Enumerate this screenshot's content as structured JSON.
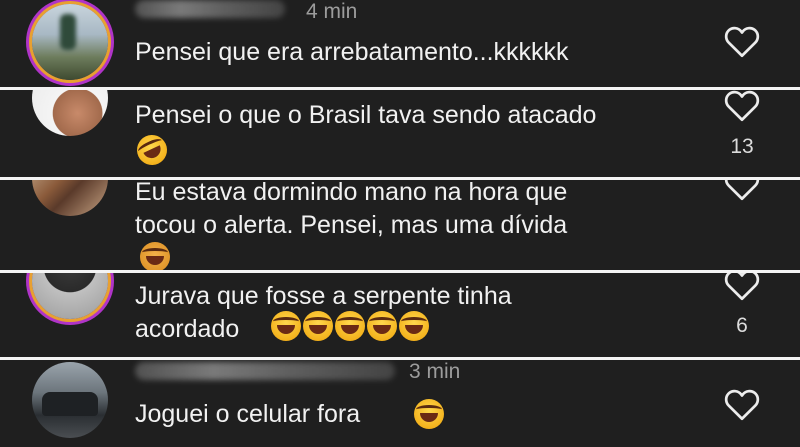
{
  "comments": [
    {
      "time": "4 min",
      "text": "Pensei que era arrebatamento...kkkkkk",
      "likes": ""
    },
    {
      "time": "",
      "text": "Pensei o que o Brasil tava sendo atacado",
      "likes": "13",
      "emoji": "rolling-laughing"
    },
    {
      "time": "",
      "text": "Eu estava dormindo mano na hora que\ntocou o alerta. Pensei, mas uma dívida",
      "likes": "",
      "emoji": "person-emoji"
    },
    {
      "time": "",
      "text": "Jurava que fosse a serpente tinha\nacordado",
      "likes": "6",
      "emoji": "tears-of-joy x5"
    },
    {
      "time": "3 min",
      "text": "Joguei o celular fora",
      "likes": "",
      "emoji": "tears-of-joy"
    }
  ],
  "colors": {
    "background": "#1f1f1f",
    "separator": "#f4f4f4",
    "text": "#f1f1f1",
    "muted": "#9c9c9c"
  }
}
